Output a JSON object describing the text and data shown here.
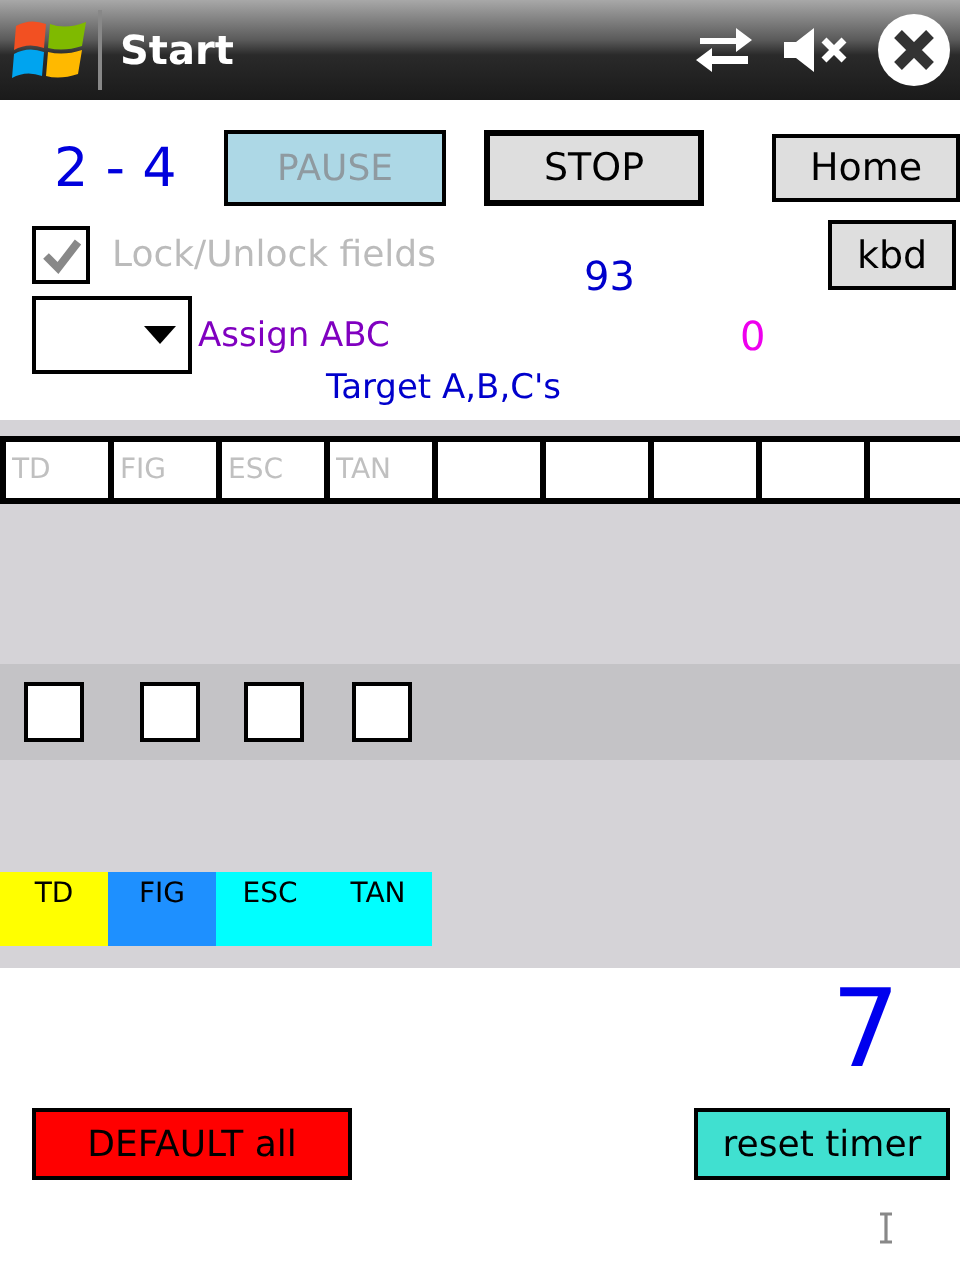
{
  "title_bar": {
    "title": "Start"
  },
  "counter": "2 - 4",
  "buttons_top": [
    {
      "label": "PAUSE",
      "kind": "pause",
      "disabled": true
    },
    {
      "label": "STOP",
      "kind": "stop",
      "disabled": false
    },
    {
      "label": "Home",
      "kind": "home",
      "disabled": false
    }
  ],
  "lock_checkbox": {
    "label": "Lock/Unlock fields",
    "checked": true,
    "disabled": true
  },
  "kbd_button": "kbd",
  "value_93": "93",
  "value_0": "0",
  "assign_label": "Assign ABC",
  "target_label": "Target A,B,C's",
  "fields": [
    {
      "kind": "text",
      "placeholder": "TD"
    },
    {
      "kind": "text",
      "placeholder": "FIG"
    },
    {
      "kind": "text",
      "placeholder": "ESC"
    },
    {
      "kind": "text",
      "placeholder": "TAN"
    },
    {
      "kind": "empty"
    },
    {
      "kind": "empty"
    },
    {
      "kind": "empty"
    },
    {
      "kind": "empty"
    },
    {
      "kind": "empty"
    }
  ],
  "checkboxes": [
    {
      "checked": false
    },
    {
      "checked": false
    },
    {
      "checked": false
    },
    {
      "checked": false
    }
  ],
  "tags": [
    {
      "label": "TD",
      "color": "#ffff00"
    },
    {
      "label": "FIG",
      "color": "#1e90ff"
    },
    {
      "label": "ESC",
      "color": "#00ffff"
    },
    {
      "label": "TAN",
      "color": "#00ffff"
    }
  ],
  "timer": "7",
  "default_button": "DEFAULT all",
  "reset_button": "reset timer"
}
